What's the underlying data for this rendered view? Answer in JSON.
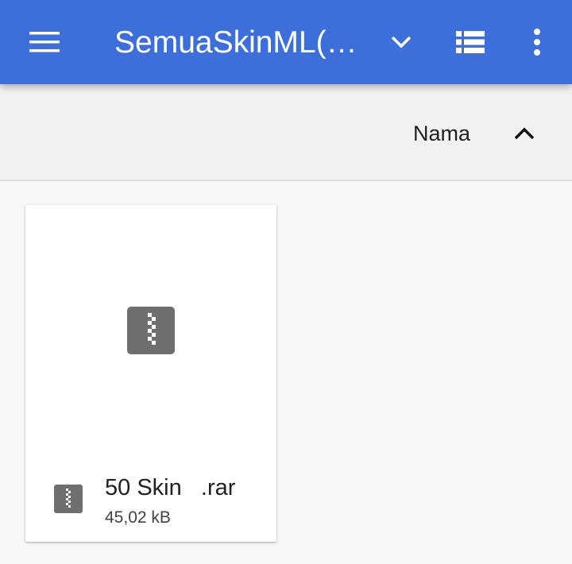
{
  "appbar": {
    "title": "SemuaSkinML(…",
    "background_color": "#3c6fd9",
    "icons": {
      "menu": "hamburger-menu-icon",
      "dropdown": "chevron-down-icon",
      "view": "list-view-icon",
      "overflow": "more-vertical-icon"
    }
  },
  "sortbar": {
    "label": "Nama",
    "direction_icon": "chevron-up-icon"
  },
  "files": [
    {
      "name": "50 Skin   .rar",
      "size": "45,02 kB",
      "icon": "archive-zip-icon"
    }
  ]
}
